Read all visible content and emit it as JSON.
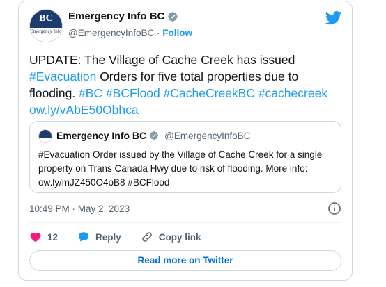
{
  "author": {
    "name": "Emergency Info BC",
    "handle": "@EmergencyInfoBC",
    "separator": "·",
    "follow_label": "Follow",
    "avatar_logo": "BC",
    "avatar_subtext": "Emergency Info",
    "verified_icon": "verified-badge-icon"
  },
  "tweet": {
    "text_parts": {
      "p1": "UPDATE: The Village of Cache Creek has issued ",
      "l1": "#Evacuation",
      "p2": " Orders for five total properties due to flooding. ",
      "l2": "#BC",
      "l3": "#BCFlood",
      "l4": "#CacheCreekBC",
      "l5": "#cachecreek",
      "l6": "ow.ly/vAbE50Obhca"
    }
  },
  "quote": {
    "name": "Emergency Info BC",
    "handle": "@EmergencyInfoBC",
    "text": "#Evacuation Order issued by the Village of Cache Creek for a single property on Trans Canada Hwy due to risk of flooding. More info: ow.ly/mJZ450O4oB8 #BCFlood"
  },
  "meta": {
    "timestamp": "10:49 PM · May 2, 2023"
  },
  "actions": {
    "like_count": "12",
    "reply_label": "Reply",
    "copy_link_label": "Copy link",
    "read_more_label": "Read more on Twitter"
  },
  "colors": {
    "link": "#1d9bf0",
    "like": "#f91880",
    "brand": "#1d3c6e"
  }
}
